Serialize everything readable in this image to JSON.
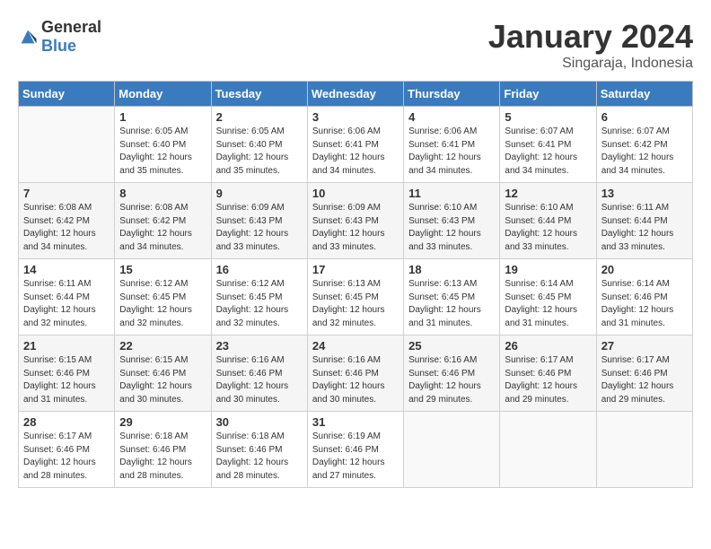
{
  "logo": {
    "general": "General",
    "blue": "Blue"
  },
  "header": {
    "month": "January 2024",
    "location": "Singaraja, Indonesia"
  },
  "days_of_week": [
    "Sunday",
    "Monday",
    "Tuesday",
    "Wednesday",
    "Thursday",
    "Friday",
    "Saturday"
  ],
  "weeks": [
    [
      {
        "day": "",
        "sunrise": "",
        "sunset": "",
        "daylight": ""
      },
      {
        "day": "1",
        "sunrise": "6:05 AM",
        "sunset": "6:40 PM",
        "daylight": "12 hours and 35 minutes."
      },
      {
        "day": "2",
        "sunrise": "6:05 AM",
        "sunset": "6:40 PM",
        "daylight": "12 hours and 35 minutes."
      },
      {
        "day": "3",
        "sunrise": "6:06 AM",
        "sunset": "6:41 PM",
        "daylight": "12 hours and 34 minutes."
      },
      {
        "day": "4",
        "sunrise": "6:06 AM",
        "sunset": "6:41 PM",
        "daylight": "12 hours and 34 minutes."
      },
      {
        "day": "5",
        "sunrise": "6:07 AM",
        "sunset": "6:41 PM",
        "daylight": "12 hours and 34 minutes."
      },
      {
        "day": "6",
        "sunrise": "6:07 AM",
        "sunset": "6:42 PM",
        "daylight": "12 hours and 34 minutes."
      }
    ],
    [
      {
        "day": "7",
        "sunrise": "6:08 AM",
        "sunset": "6:42 PM",
        "daylight": "12 hours and 34 minutes."
      },
      {
        "day": "8",
        "sunrise": "6:08 AM",
        "sunset": "6:42 PM",
        "daylight": "12 hours and 34 minutes."
      },
      {
        "day": "9",
        "sunrise": "6:09 AM",
        "sunset": "6:43 PM",
        "daylight": "12 hours and 33 minutes."
      },
      {
        "day": "10",
        "sunrise": "6:09 AM",
        "sunset": "6:43 PM",
        "daylight": "12 hours and 33 minutes."
      },
      {
        "day": "11",
        "sunrise": "6:10 AM",
        "sunset": "6:43 PM",
        "daylight": "12 hours and 33 minutes."
      },
      {
        "day": "12",
        "sunrise": "6:10 AM",
        "sunset": "6:44 PM",
        "daylight": "12 hours and 33 minutes."
      },
      {
        "day": "13",
        "sunrise": "6:11 AM",
        "sunset": "6:44 PM",
        "daylight": "12 hours and 33 minutes."
      }
    ],
    [
      {
        "day": "14",
        "sunrise": "6:11 AM",
        "sunset": "6:44 PM",
        "daylight": "12 hours and 32 minutes."
      },
      {
        "day": "15",
        "sunrise": "6:12 AM",
        "sunset": "6:45 PM",
        "daylight": "12 hours and 32 minutes."
      },
      {
        "day": "16",
        "sunrise": "6:12 AM",
        "sunset": "6:45 PM",
        "daylight": "12 hours and 32 minutes."
      },
      {
        "day": "17",
        "sunrise": "6:13 AM",
        "sunset": "6:45 PM",
        "daylight": "12 hours and 32 minutes."
      },
      {
        "day": "18",
        "sunrise": "6:13 AM",
        "sunset": "6:45 PM",
        "daylight": "12 hours and 31 minutes."
      },
      {
        "day": "19",
        "sunrise": "6:14 AM",
        "sunset": "6:45 PM",
        "daylight": "12 hours and 31 minutes."
      },
      {
        "day": "20",
        "sunrise": "6:14 AM",
        "sunset": "6:46 PM",
        "daylight": "12 hours and 31 minutes."
      }
    ],
    [
      {
        "day": "21",
        "sunrise": "6:15 AM",
        "sunset": "6:46 PM",
        "daylight": "12 hours and 31 minutes."
      },
      {
        "day": "22",
        "sunrise": "6:15 AM",
        "sunset": "6:46 PM",
        "daylight": "12 hours and 30 minutes."
      },
      {
        "day": "23",
        "sunrise": "6:16 AM",
        "sunset": "6:46 PM",
        "daylight": "12 hours and 30 minutes."
      },
      {
        "day": "24",
        "sunrise": "6:16 AM",
        "sunset": "6:46 PM",
        "daylight": "12 hours and 30 minutes."
      },
      {
        "day": "25",
        "sunrise": "6:16 AM",
        "sunset": "6:46 PM",
        "daylight": "12 hours and 29 minutes."
      },
      {
        "day": "26",
        "sunrise": "6:17 AM",
        "sunset": "6:46 PM",
        "daylight": "12 hours and 29 minutes."
      },
      {
        "day": "27",
        "sunrise": "6:17 AM",
        "sunset": "6:46 PM",
        "daylight": "12 hours and 29 minutes."
      }
    ],
    [
      {
        "day": "28",
        "sunrise": "6:17 AM",
        "sunset": "6:46 PM",
        "daylight": "12 hours and 28 minutes."
      },
      {
        "day": "29",
        "sunrise": "6:18 AM",
        "sunset": "6:46 PM",
        "daylight": "12 hours and 28 minutes."
      },
      {
        "day": "30",
        "sunrise": "6:18 AM",
        "sunset": "6:46 PM",
        "daylight": "12 hours and 28 minutes."
      },
      {
        "day": "31",
        "sunrise": "6:19 AM",
        "sunset": "6:46 PM",
        "daylight": "12 hours and 27 minutes."
      },
      {
        "day": "",
        "sunrise": "",
        "sunset": "",
        "daylight": ""
      },
      {
        "day": "",
        "sunrise": "",
        "sunset": "",
        "daylight": ""
      },
      {
        "day": "",
        "sunrise": "",
        "sunset": "",
        "daylight": ""
      }
    ]
  ],
  "cell_labels": {
    "sunrise_prefix": "Sunrise: ",
    "sunset_prefix": "Sunset: ",
    "daylight_prefix": "Daylight: "
  }
}
